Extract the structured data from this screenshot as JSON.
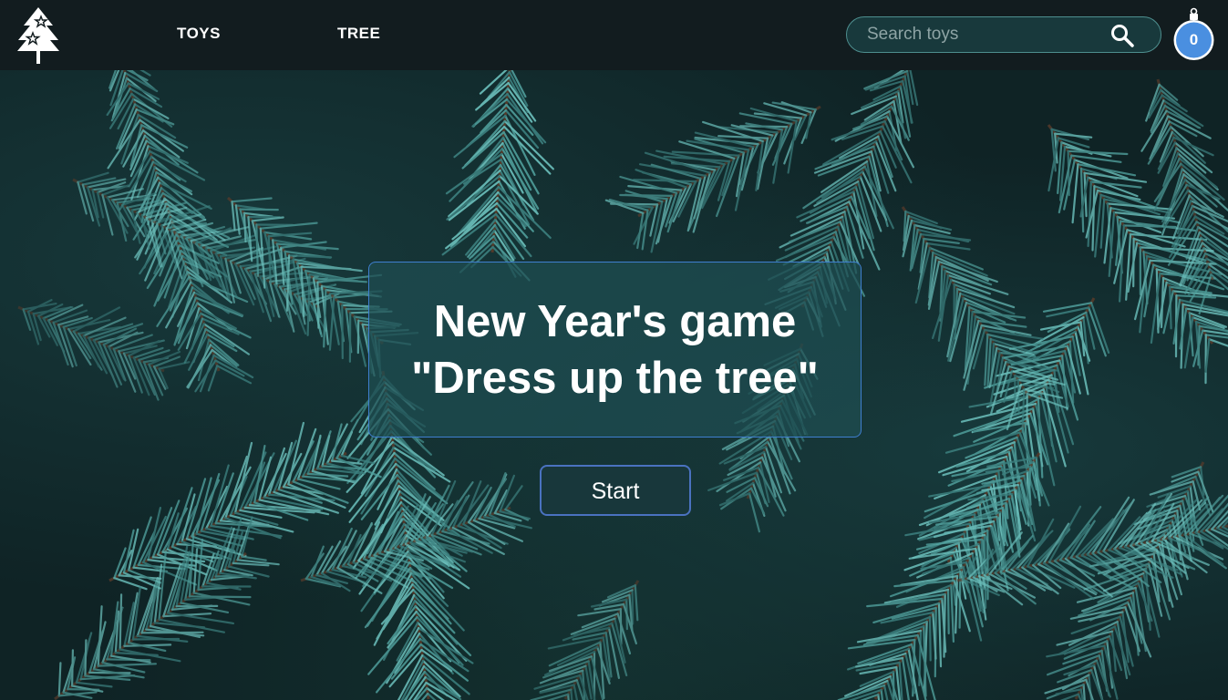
{
  "header": {
    "logo_icon": "christmas-tree-logo-icon",
    "nav": [
      {
        "label": "TOYS"
      },
      {
        "label": "TREE"
      }
    ],
    "search": {
      "placeholder": "Search toys",
      "value": "",
      "icon": "search-icon"
    },
    "favorites": {
      "icon": "ornament-ball-icon",
      "count": "0",
      "color": "#4a8fe0"
    }
  },
  "main": {
    "title_line1": "New Year's game",
    "title_line2": "\"Dress up the tree\"",
    "start_label": "Start",
    "background": "pine-branches-photo"
  },
  "colors": {
    "header_bg": "#121c1f",
    "accent_border": "#3f7fd0",
    "card_bg": "#1e4e52",
    "needle": "#5fb3b0"
  }
}
